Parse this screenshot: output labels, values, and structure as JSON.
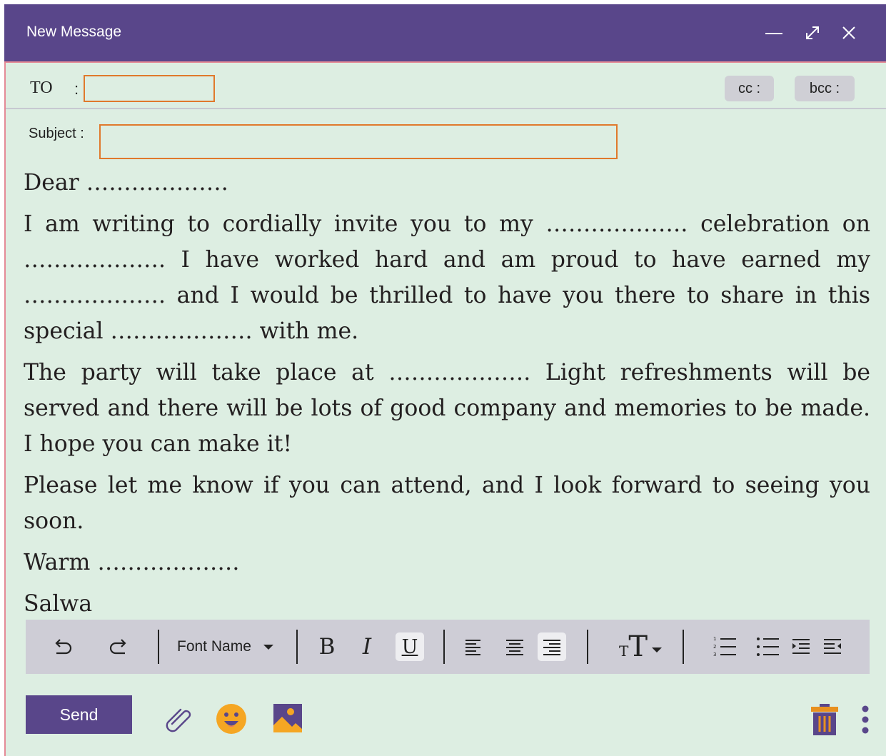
{
  "window": {
    "title": "New Message",
    "controls": [
      "minimize-icon",
      "expand-icon",
      "close-icon"
    ]
  },
  "header": {
    "to_label": "TO",
    "to_colon": ":",
    "to_value": "",
    "cc_label": "cc :",
    "bcc_label": "bcc :",
    "subject_label": "Subject :",
    "subject_value": ""
  },
  "message": {
    "paragraphs": [
      "Dear ……………….",
      "I am writing to cordially invite you to my ………………. celebration on ………………. I have worked hard and am proud to have earned my ………………. and I would be thrilled to have you there to share in this special ………………. with me.",
      "The party will take place at ………………. Light refreshments will be served and there will be lots of good company and memories to be made. I hope you can make it!",
      "Please let me know if you can attend, and I look forward to seeing you soon.",
      "Warm ……………….",
      "Salwa"
    ]
  },
  "toolbar": {
    "font_name": "Font Name",
    "bold": "B",
    "italic": "I",
    "underline": "U",
    "text_size_small": "T",
    "text_size_large": "T",
    "tools": [
      "undo-icon",
      "redo-icon",
      "align-left-icon",
      "align-center-icon",
      "align-right-icon",
      "numbered-list-icon",
      "bullet-list-icon",
      "indent-icon",
      "outdent-icon"
    ]
  },
  "footer": {
    "send_label": "Send",
    "icons": [
      "attach-icon",
      "emoji-icon",
      "image-icon",
      "trash-icon",
      "more-vertical-icon"
    ]
  },
  "colors": {
    "accent": "#59468a",
    "background": "#ddeee2",
    "input_border": "#e0792c",
    "toolbar": "#cecdd6",
    "emoji": "#f5a623",
    "trash": "#e8901f"
  }
}
